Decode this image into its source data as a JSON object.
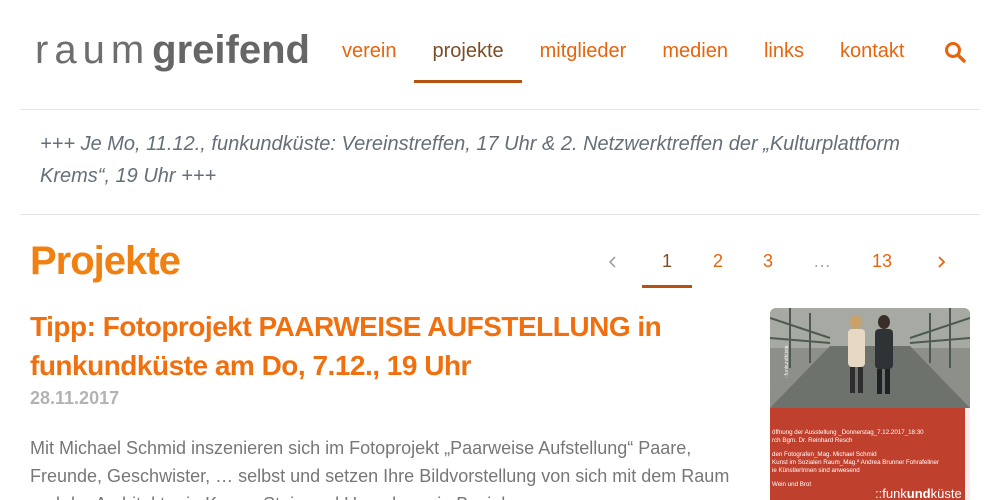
{
  "header": {
    "logo_light": "raum",
    "logo_bold": "greifend",
    "nav": [
      {
        "label": "verein"
      },
      {
        "label": "projekte",
        "active": true
      },
      {
        "label": "mitglieder"
      },
      {
        "label": "medien"
      },
      {
        "label": "links"
      },
      {
        "label": "kontakt"
      }
    ],
    "search_icon": "search-icon"
  },
  "ticker": {
    "text": "+++ Je Mo, 11.12., funkundküste: Vereinstreffen, 17 Uhr & 2. Netzwerktreffen der „Kulturplattform Krems“, 19 Uhr +++"
  },
  "section": {
    "title": "Projekte"
  },
  "pagination": {
    "prev_icon": "chevron-left-icon",
    "pages": [
      "1",
      "2",
      "3"
    ],
    "current": "1",
    "ellipsis": "…",
    "last": "13",
    "next_icon": "chevron-right-icon"
  },
  "article": {
    "title": "Tipp: Fotoprojekt PAARWEISE AUFSTELLUNG in funkundküste am Do, 7.12., 19 Uhr",
    "date": "28.11.2017",
    "excerpt": "Mit Michael Schmid inszenieren sich im Fotoprojekt „Paarweise Aufstellung“ Paare, Freunde, Geschwister, … selbst und setzen Ihre Bildvorstellung von sich mit dem Raum und der Architektur in Krems-Stein und Umgebung in Beziehung.",
    "image": {
      "poster_lines": [
        "öffnung der Ausstellung _Donnerstag_7.12.2017_18:30",
        "rch Bgm. Dr. Reinhard Resch",
        "den Fotografen_Mag. Michael Schmid",
        "Kunst im Sozialen Raum_Mag.ª Andrea Brunner Fohrafellner",
        "ie KünstlerInnen sind anwesend",
        "Wein und Brot"
      ],
      "poster_brand_light": "::funk",
      "poster_brand_bold": "und",
      "poster_brand_end": "küste",
      "side_text": "::funkundküste",
      "colors": {
        "poster_red": "#c0402e",
        "photo_gray": "#8c9088"
      }
    }
  },
  "colors": {
    "accent": "#e8640c",
    "active_nav": "#7a4e26",
    "active_underline": "#b6510f",
    "title_orange": "#f08010",
    "ticker_text": "#666e78",
    "date_gray": "#b3b3b3",
    "body_text": "#777777"
  }
}
